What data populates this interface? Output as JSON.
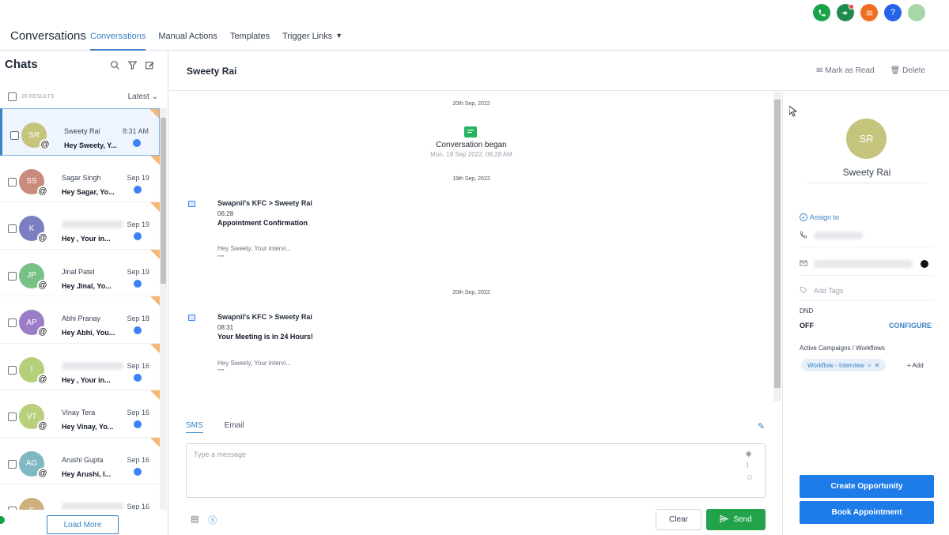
{
  "header": {
    "app_title": "Conversations",
    "tabs": [
      {
        "label": "Conversations"
      },
      {
        "label": "Manual Actions"
      },
      {
        "label": "Templates"
      },
      {
        "label": "Trigger Links"
      }
    ],
    "icons": [
      "phone-icon",
      "megaphone-icon",
      "list-icon",
      "help-icon",
      "user-avatar"
    ],
    "colors": {
      "accent": "#3b82c4",
      "send_green": "#22a34a",
      "primary_blue": "#1e7ce8"
    }
  },
  "sidebar": {
    "title": "Chats",
    "results_label": "26 RESULTS",
    "sort_label": "Latest",
    "load_more": "Load More",
    "chats": [
      {
        "initials": "SR",
        "name": "Sweety Rai",
        "preview": "Hey Sweety, Y...",
        "time": "8:31 AM",
        "color": "#c5c47d",
        "unread": true
      },
      {
        "initials": "SS",
        "name": "Sagar Singh",
        "preview": "Hey Sagar, Yo...",
        "time": "Sep 19",
        "color": "#c98b7c",
        "unread": true
      },
      {
        "initials": "K",
        "name": "",
        "preview": "Hey , Your in...",
        "time": "Sep 19",
        "color": "#7b7fc1",
        "unread": true
      },
      {
        "initials": "JP",
        "name": "Jinal Patel",
        "preview": "Hey Jinal, Yo...",
        "time": "Sep 19",
        "color": "#78c186",
        "unread": true
      },
      {
        "initials": "AP",
        "name": "Abhi Pranay",
        "preview": "Hey Abhi, You...",
        "time": "Sep 18",
        "color": "#9b7cc6",
        "unread": true
      },
      {
        "initials": "I",
        "name": "",
        "preview": "Hey , Your in...",
        "time": "Sep 16",
        "color": "#b5cf7a",
        "unread": true
      },
      {
        "initials": "VT",
        "name": "Vinay Tera",
        "preview": "Hey Vinay, Yo...",
        "time": "Sep 16",
        "color": "#b8cf7b",
        "unread": true
      },
      {
        "initials": "AG",
        "name": "Arushi Gupta",
        "preview": "Hey Arushi, I...",
        "time": "Sep 16",
        "color": "#7fb7c2",
        "unread": true
      },
      {
        "initials": "S",
        "name": "",
        "preview": "",
        "time": "Sep 16",
        "color": "#cdb07e",
        "unread": false
      }
    ]
  },
  "conversation": {
    "contact_name": "Sweety Rai",
    "mark_read": "Mark as Read",
    "delete": "Delete",
    "date1": "20th Sep, 2022",
    "began_title": "Conversation began",
    "began_sub": "Mon, 19 Sep 2022, 06:28 AM",
    "date2": "19th Sep, 2022",
    "msg1": {
      "from": "Swapnil's KFC > Sweety Rai",
      "time": "06:28",
      "subject": "Appointment Confirmation",
      "preview": "Hey Sweety, Your intervi...",
      "more": "\"\"\""
    },
    "date3": "20th Sep, 2022",
    "msg2": {
      "from": "Swapnil's KFC > Sweety Rai",
      "time": "08:31",
      "subject": "Your Meeting is in 24 Hours!",
      "preview": "Hey Sweety, Your intervi...",
      "more": "\"\"\""
    }
  },
  "composer": {
    "tab_sms": "SMS",
    "tab_email": "Email",
    "placeholder": "Type a message",
    "clear": "Clear",
    "send": "Send"
  },
  "contact": {
    "initials": "SR",
    "name": "Sweety Rai",
    "assign_to": "Assign to",
    "add_tags": "Add Tags",
    "dnd_label": "DND",
    "dnd_value": "OFF",
    "configure": "CONFIGURE",
    "campaigns_label": "Active Campaigns / Workflows",
    "workflow_chip": "Workflow - Interview",
    "add": "+ Add",
    "create_opportunity": "Create Opportunity",
    "book_appointment": "Book Appointment"
  }
}
